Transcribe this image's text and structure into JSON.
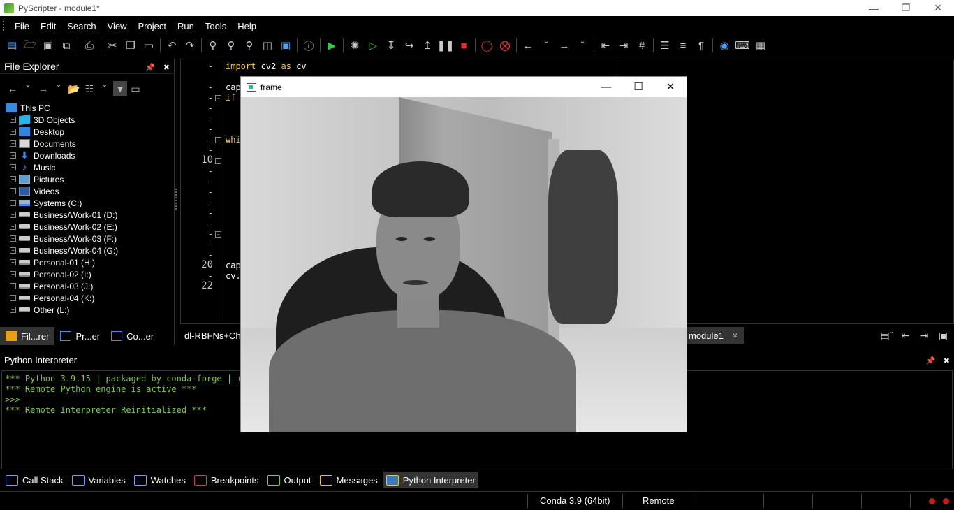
{
  "window": {
    "title": "PyScripter - module1*"
  },
  "menu": [
    "File",
    "Edit",
    "Search",
    "View",
    "Project",
    "Run",
    "Tools",
    "Help"
  ],
  "file_explorer": {
    "title": "File Explorer",
    "root": "This PC",
    "items": [
      {
        "label": "3D Objects",
        "icon": "3d-objects-icon"
      },
      {
        "label": "Desktop",
        "icon": "desktop-icon"
      },
      {
        "label": "Documents",
        "icon": "documents-icon"
      },
      {
        "label": "Downloads",
        "icon": "downloads-icon"
      },
      {
        "label": "Music",
        "icon": "music-icon"
      },
      {
        "label": "Pictures",
        "icon": "pictures-icon"
      },
      {
        "label": "Videos",
        "icon": "videos-icon"
      },
      {
        "label": "Systems (C:)",
        "icon": "system-drive-icon"
      },
      {
        "label": "Business/Work-01 (D:)",
        "icon": "drive-icon"
      },
      {
        "label": "Business/Work-02 (E:)",
        "icon": "drive-icon"
      },
      {
        "label": "Business/Work-03 (F:)",
        "icon": "drive-icon"
      },
      {
        "label": "Business/Work-04 (G:)",
        "icon": "drive-icon"
      },
      {
        "label": "Personal-01 (H:)",
        "icon": "drive-icon"
      },
      {
        "label": "Personal-02 (I:)",
        "icon": "drive-icon"
      },
      {
        "label": "Personal-03 (J:)",
        "icon": "drive-icon"
      },
      {
        "label": "Personal-04 (K:)",
        "icon": "drive-icon"
      },
      {
        "label": "Other (L:)",
        "icon": "drive-icon"
      }
    ],
    "tabs": [
      "Fil...rer",
      "Pr...er",
      "Co...er"
    ]
  },
  "editor": {
    "line_numbers": {
      "l10": "10",
      "l20": "20",
      "l22": "22"
    },
    "code": {
      "line1_kw1": "import",
      "line1_mid": " cv2 ",
      "line1_kw2": "as",
      "line1_end": " cv",
      "cap1": "cap",
      "if": "if",
      "whi": "whi",
      "cap2": "cap",
      "cv": "cv."
    },
    "tabs": {
      "left": "dl-RBFNs+Cha",
      "active": "module1"
    }
  },
  "interpreter": {
    "title": "Python Interpreter",
    "lines": [
      "*** Python 3.9.15 | packaged by conda-forge | (m",
      "*** Remote Python engine is active ***",
      ">>>",
      "*** Remote Interpreter Reinitialized ***"
    ]
  },
  "bottom_tabs": [
    "Call Stack",
    "Variables",
    "Watches",
    "Breakpoints",
    "Output",
    "Messages",
    "Python Interpreter"
  ],
  "status": {
    "engine": "Conda 3.9 (64bit)",
    "mode": "Remote"
  },
  "frame_window": {
    "title": "frame"
  },
  "colors": {
    "accent_green": "#7ec850",
    "keyword": "#f0d040",
    "status_red": "#c0201c"
  }
}
